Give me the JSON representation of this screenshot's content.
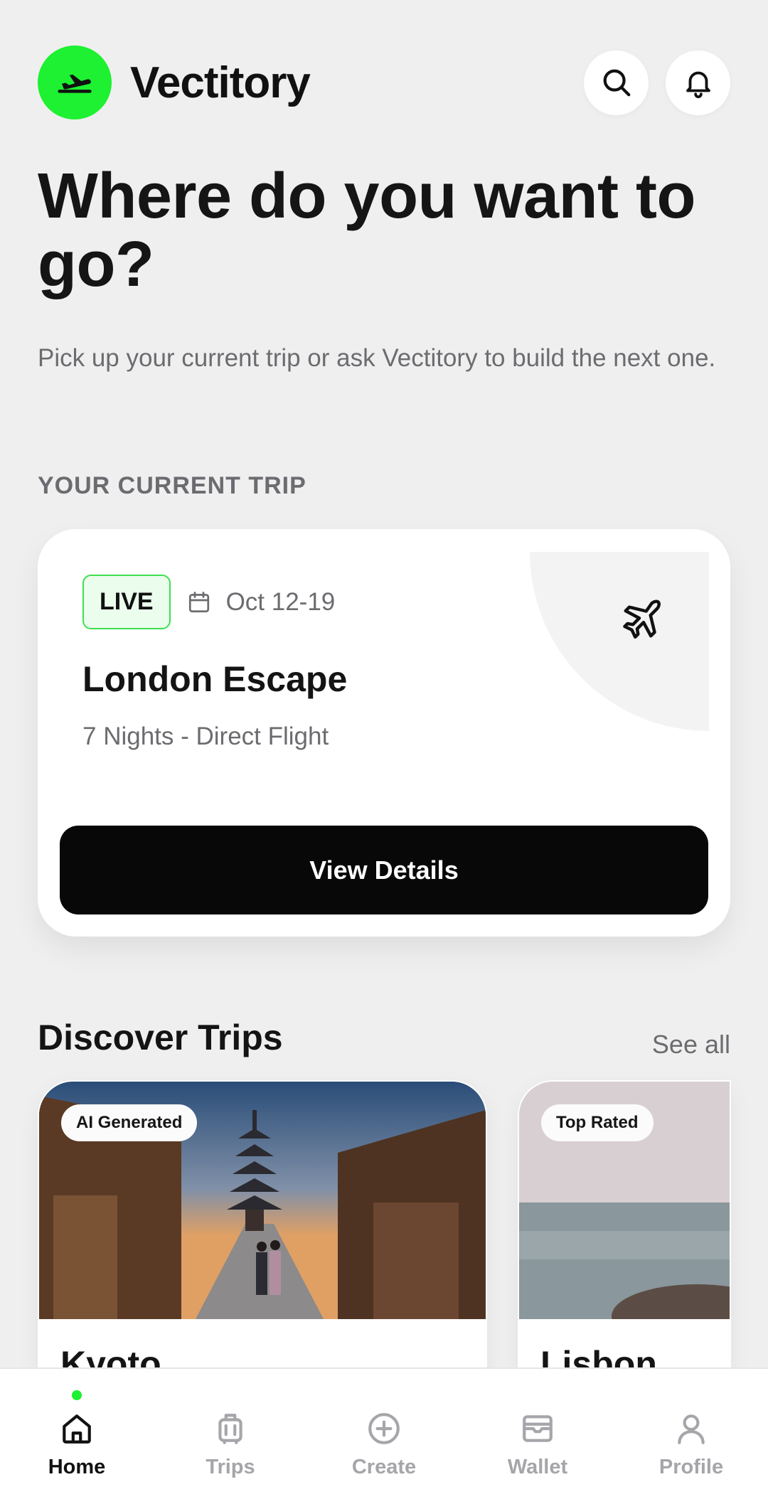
{
  "app": {
    "name": "Vectitory",
    "accent": "#1df131"
  },
  "header": {
    "logo_icon": "plane-departure-icon",
    "search_icon": "search-icon",
    "bell_icon": "bell-icon"
  },
  "hero": {
    "title": "Where do you want to go?",
    "subtitle": "Pick up your current trip or ask Vectitory to build the next one."
  },
  "current_trip": {
    "section_label": "YOUR CURRENT TRIP",
    "status": "LIVE",
    "dates": "Oct 12-19",
    "title": "London Escape",
    "details": "7 Nights - Direct Flight",
    "button_label": "View Details"
  },
  "discover": {
    "title": "Discover Trips",
    "see_all": "See all",
    "cards": [
      {
        "badge": "AI Generated",
        "name": "Kyoto"
      },
      {
        "badge": "Top Rated",
        "name": "Lisbon"
      }
    ]
  },
  "nav": {
    "items": [
      {
        "label": "Home",
        "icon": "home-icon",
        "active": true
      },
      {
        "label": "Trips",
        "icon": "luggage-icon",
        "active": false
      },
      {
        "label": "Create",
        "icon": "plus-circle-icon",
        "active": false
      },
      {
        "label": "Wallet",
        "icon": "wallet-icon",
        "active": false
      },
      {
        "label": "Profile",
        "icon": "profile-icon",
        "active": false
      }
    ]
  }
}
